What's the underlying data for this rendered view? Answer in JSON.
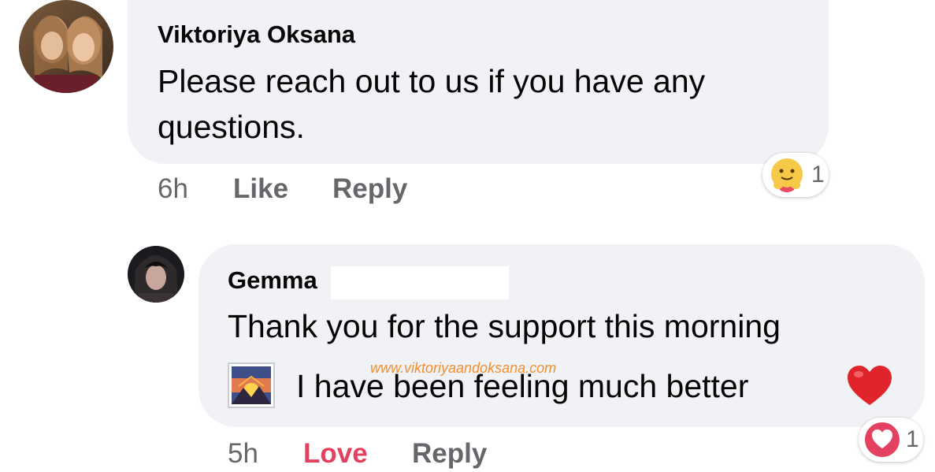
{
  "comments": [
    {
      "author": "Viktoriya Oksana",
      "text": "Please reach out to us if you have any questions.",
      "time": "6h",
      "like_label": "Like",
      "reply_label": "Reply",
      "reaction": {
        "icon": "care-reaction-icon",
        "count": "1"
      }
    },
    {
      "author": "Gemma",
      "text_line1": "Thank you for the support this morning",
      "text_line2": "I have been feeling much better",
      "emoji_left": "sunrise-over-mountains-icon",
      "emoji_right": "red-heart-icon",
      "time": "5h",
      "like_label": "Love",
      "reply_label": "Reply",
      "reaction": {
        "icon": "love-reaction-icon",
        "count": "1"
      }
    }
  ],
  "watermark": "www.viktoriyaandoksana.com",
  "colors": {
    "bubble": "#f0f2f5",
    "meta_gray": "#65676b",
    "love_red": "#e4405f",
    "watermark_orange": "#f08a24"
  }
}
